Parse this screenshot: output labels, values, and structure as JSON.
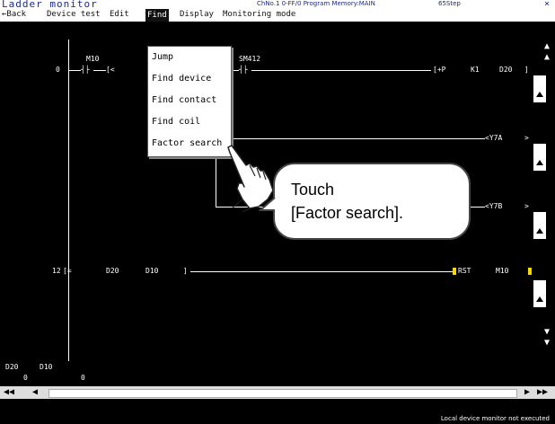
{
  "titlebar": {
    "title": "Ladder monitor",
    "info": "ChNo.1 0-FF/0 Program Memory:MAIN",
    "steps": "65Step",
    "close": "×"
  },
  "menubar": {
    "back": "←Back",
    "device_test": "Device test",
    "edit": "Edit",
    "find": "Find",
    "display": "Display",
    "monitoring_mode": "Monitoring mode"
  },
  "find_menu": {
    "items": [
      "Jump",
      "Find device",
      "Find contact",
      "Find coil",
      "Factor search"
    ]
  },
  "ladder": {
    "rung1": {
      "step": "0",
      "contact1": "M10",
      "bracket": "[<",
      "contact2": "SM412",
      "instruction": "[+P",
      "arg1": "K1",
      "arg2": "D20",
      "end": "]"
    },
    "rung2": {
      "coil": "<Y7A",
      "end": ">"
    },
    "rung3": {
      "coil": "<Y7B",
      "end": ">"
    },
    "rung4": {
      "step": "12",
      "instruction": "[=",
      "arg1": "D20",
      "arg2": "D10",
      "end": "]",
      "rst": "RST",
      "target": "M10"
    }
  },
  "device_values": {
    "labels": [
      "D20",
      "D10"
    ],
    "values": [
      "0",
      "0"
    ]
  },
  "scroll": {
    "left_fast": "◀◀",
    "left": "◀",
    "right": "▶",
    "right_fast": "▶▶"
  },
  "status": {
    "message": "Local device monitor not executed"
  },
  "callout": {
    "line1": "Touch",
    "line2": "[Factor search]."
  },
  "colors": {
    "background": "#000000",
    "ladder_line": "#ffffff",
    "rst_mark": "#ffd400",
    "title_text": "#1a2a8c"
  }
}
